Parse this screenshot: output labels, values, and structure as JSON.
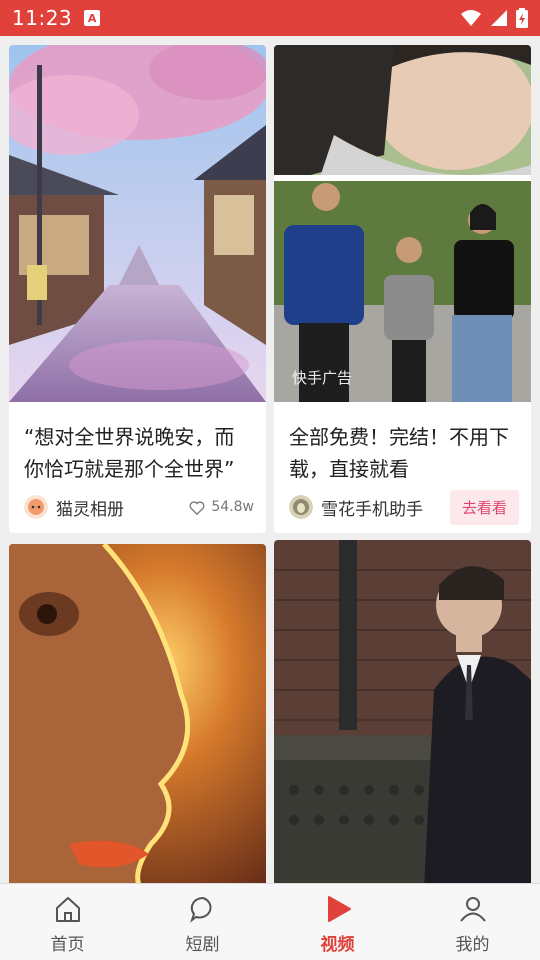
{
  "status": {
    "time": "11:23",
    "notif": "A"
  },
  "cards": [
    {
      "title": "“想对全世界说晚安，而你恰巧就是那个全世界”",
      "author": "猫灵相册",
      "likes": "54.8w"
    },
    {
      "title": "全部免费！完结！不用下载，直接就看",
      "author": "雪花手机助手",
      "cta": "去看看",
      "ad_label": "快手广告"
    }
  ],
  "tabs": [
    {
      "label": "首页",
      "icon": "home-icon"
    },
    {
      "label": "短剧",
      "icon": "chat-bubble-icon"
    },
    {
      "label": "视频",
      "icon": "play-icon"
    },
    {
      "label": "我的",
      "icon": "person-icon"
    }
  ],
  "colors": {
    "accent": "#e0413b",
    "cta_bg": "#fde8ec",
    "cta_text": "#e0456d"
  }
}
